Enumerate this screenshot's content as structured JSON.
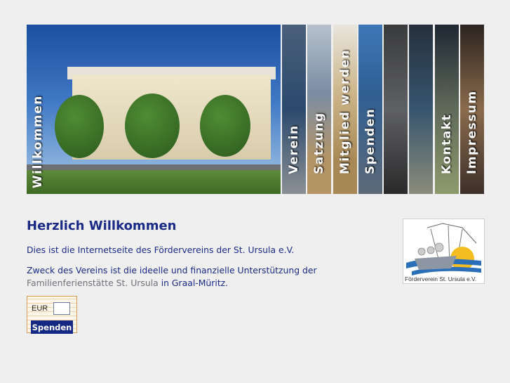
{
  "nav": {
    "items": [
      {
        "key": "willkommen",
        "label": "Willkommen",
        "bg": "#3f6fb6"
      },
      {
        "key": "verein",
        "label": "Verein",
        "bg": "#3c5474"
      },
      {
        "key": "satzung",
        "label": "Satzung",
        "bg": "#6a7e94"
      },
      {
        "key": "mitglied-werden",
        "label": "Mitglied werden",
        "bg": "#c9b48c"
      },
      {
        "key": "spenden",
        "label": "Spenden",
        "bg": "#2d5c8e"
      },
      {
        "key": "kontakt-dark",
        "label": "",
        "bg": "#4b4d50"
      },
      {
        "key": "sea",
        "label": "",
        "bg": "#2c3e52"
      },
      {
        "key": "kontakt",
        "label": "Kontakt",
        "bg": "#6f7a5c"
      },
      {
        "key": "impressum",
        "label": "Impressum",
        "bg": "#5b4a3a"
      }
    ]
  },
  "main": {
    "heading": "Herzlich Willkommen",
    "intro": "Dies ist die Internetseite des Fördervereins der St. Ursula e.V.",
    "purpose_before": "Zweck des Vereins ist die ideelle und finanzielle Unterstützung der",
    "purpose_link": "Familienferienstätte St. Ursula",
    "purpose_after": "in Graal-Müritz."
  },
  "donate": {
    "currency_label": "EUR",
    "amount_value": "",
    "button_label": "Spenden"
  },
  "logo": {
    "caption": "Förderverein St. Ursula e.V."
  },
  "colors": {
    "text": "#1a2a86",
    "link": "#6f7277",
    "button": "#132783",
    "background": "#efefef"
  }
}
